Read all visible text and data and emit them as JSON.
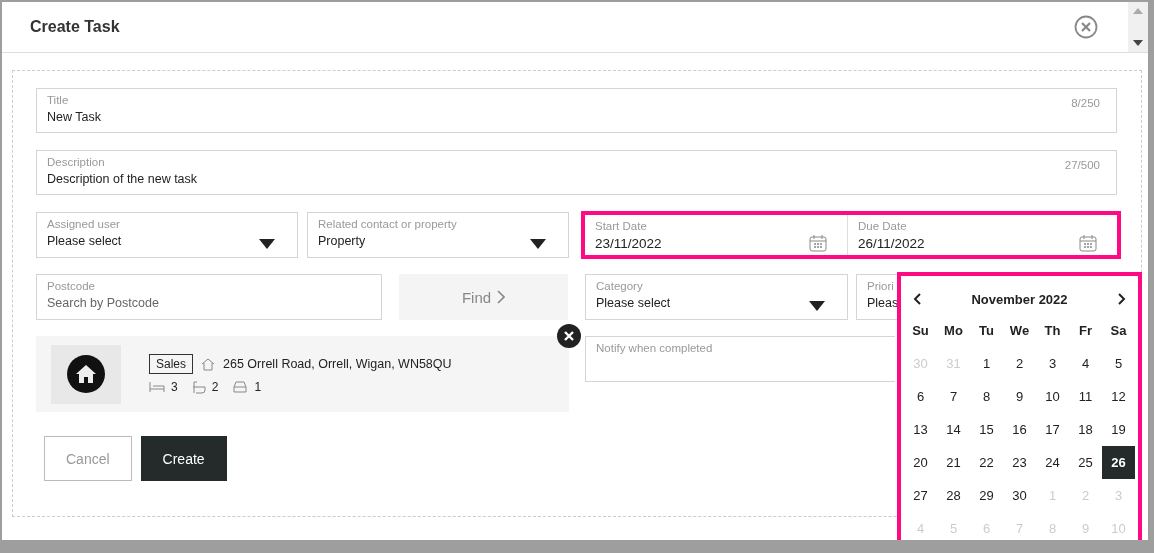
{
  "dialog": {
    "title": "Create Task"
  },
  "title_field": {
    "label": "Title",
    "value": "New Task",
    "counter": "8/250"
  },
  "description_field": {
    "label": "Description",
    "value": "Description of the new task",
    "counter": "27/500"
  },
  "assigned_user": {
    "label": "Assigned user",
    "value": "Please select"
  },
  "related": {
    "label": "Related contact or property",
    "value": "Property"
  },
  "start_date": {
    "label": "Start Date",
    "value": "23/11/2022"
  },
  "due_date": {
    "label": "Due Date",
    "value": "26/11/2022"
  },
  "postcode": {
    "label": "Postcode",
    "placeholder": "Search by Postcode"
  },
  "find_button": {
    "label": "Find",
    "disabled": true
  },
  "category": {
    "label": "Category",
    "value": "Please select"
  },
  "priority": {
    "label": "Priori",
    "value": "Pleas"
  },
  "property": {
    "tag": "Sales",
    "address": "265 Orrell Road, Orrell, Wigan, WN58QU",
    "bedrooms": "3",
    "bathrooms": "2",
    "parking": "1"
  },
  "notify": {
    "label": "Notify when completed"
  },
  "buttons": [
    {
      "label": "Cancel",
      "kind": "secondary"
    },
    {
      "label": "Create",
      "kind": "primary"
    }
  ],
  "calendar": {
    "month": "November 2022",
    "weekdays": [
      "Su",
      "Mo",
      "Tu",
      "We",
      "Th",
      "Fr",
      "Sa"
    ],
    "weeks": [
      [
        {
          "day": "30",
          "outside": true,
          "selected": false
        },
        {
          "day": "31",
          "outside": true,
          "selected": false
        },
        {
          "day": "1",
          "outside": false,
          "selected": false
        },
        {
          "day": "2",
          "outside": false,
          "selected": false
        },
        {
          "day": "3",
          "outside": false,
          "selected": false
        },
        {
          "day": "4",
          "outside": false,
          "selected": false
        },
        {
          "day": "5",
          "outside": false,
          "selected": false
        }
      ],
      [
        {
          "day": "6",
          "outside": false,
          "selected": false
        },
        {
          "day": "7",
          "outside": false,
          "selected": false
        },
        {
          "day": "8",
          "outside": false,
          "selected": false
        },
        {
          "day": "9",
          "outside": false,
          "selected": false
        },
        {
          "day": "10",
          "outside": false,
          "selected": false
        },
        {
          "day": "11",
          "outside": false,
          "selected": false
        },
        {
          "day": "12",
          "outside": false,
          "selected": false
        }
      ],
      [
        {
          "day": "13",
          "outside": false,
          "selected": false
        },
        {
          "day": "14",
          "outside": false,
          "selected": false
        },
        {
          "day": "15",
          "outside": false,
          "selected": false
        },
        {
          "day": "16",
          "outside": false,
          "selected": false
        },
        {
          "day": "17",
          "outside": false,
          "selected": false
        },
        {
          "day": "18",
          "outside": false,
          "selected": false
        },
        {
          "day": "19",
          "outside": false,
          "selected": false
        }
      ],
      [
        {
          "day": "20",
          "outside": false,
          "selected": false
        },
        {
          "day": "21",
          "outside": false,
          "selected": false
        },
        {
          "day": "22",
          "outside": false,
          "selected": false
        },
        {
          "day": "23",
          "outside": false,
          "selected": false
        },
        {
          "day": "24",
          "outside": false,
          "selected": false
        },
        {
          "day": "25",
          "outside": false,
          "selected": false
        },
        {
          "day": "26",
          "outside": false,
          "selected": true
        }
      ],
      [
        {
          "day": "27",
          "outside": false,
          "selected": false
        },
        {
          "day": "28",
          "outside": false,
          "selected": false
        },
        {
          "day": "29",
          "outside": false,
          "selected": false
        },
        {
          "day": "30",
          "outside": false,
          "selected": false
        },
        {
          "day": "1",
          "outside": true,
          "selected": false
        },
        {
          "day": "2",
          "outside": true,
          "selected": false
        },
        {
          "day": "3",
          "outside": true,
          "selected": false
        }
      ],
      [
        {
          "day": "4",
          "outside": true,
          "selected": false
        },
        {
          "day": "5",
          "outside": true,
          "selected": false
        },
        {
          "day": "6",
          "outside": true,
          "selected": false
        },
        {
          "day": "7",
          "outside": true,
          "selected": false
        },
        {
          "day": "8",
          "outside": true,
          "selected": false
        },
        {
          "day": "9",
          "outside": true,
          "selected": false
        },
        {
          "day": "10",
          "outside": true,
          "selected": false
        }
      ]
    ]
  }
}
